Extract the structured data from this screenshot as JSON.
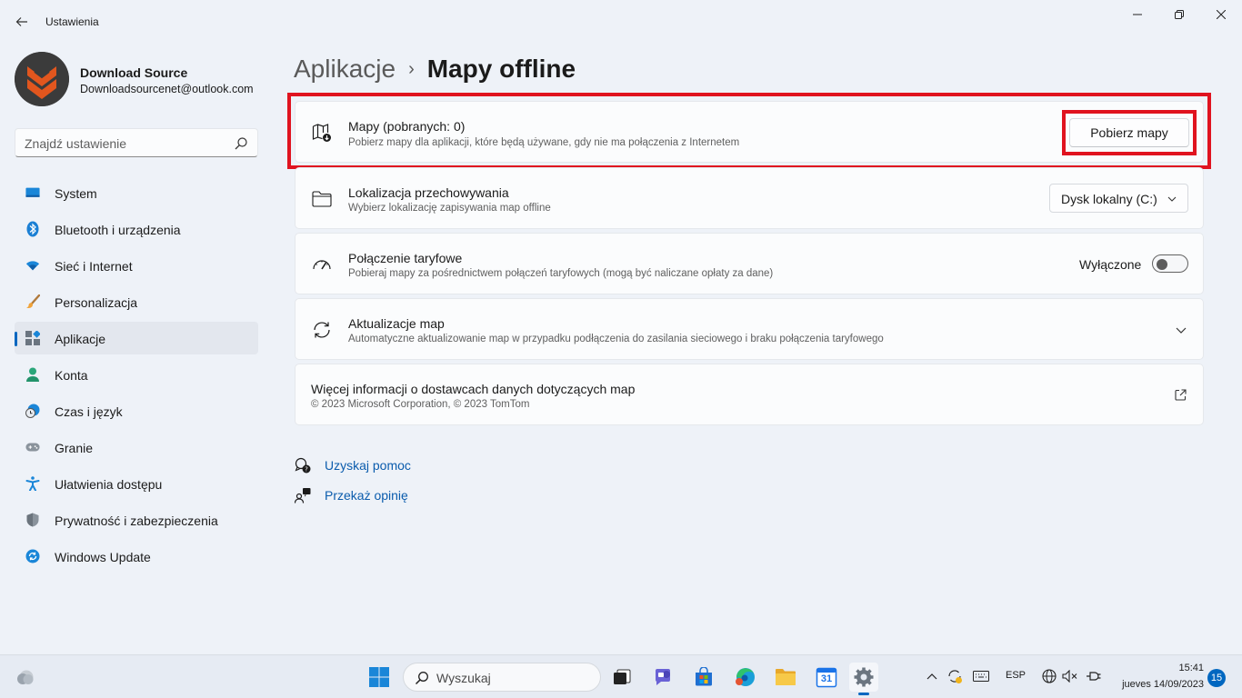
{
  "window": {
    "title": "Ustawienia"
  },
  "profile": {
    "name": "Download Source",
    "email": "Downloadsourcenet@outlook.com"
  },
  "search": {
    "placeholder": "Znajdź ustawienie"
  },
  "sidebar": {
    "items": [
      {
        "label": "System",
        "icon": "system-icon"
      },
      {
        "label": "Bluetooth i urządzenia",
        "icon": "bluetooth-icon"
      },
      {
        "label": "Sieć i Internet",
        "icon": "wifi-icon"
      },
      {
        "label": "Personalizacja",
        "icon": "brush-icon"
      },
      {
        "label": "Aplikacje",
        "icon": "apps-icon",
        "active": true
      },
      {
        "label": "Konta",
        "icon": "person-icon"
      },
      {
        "label": "Czas i język",
        "icon": "clock-globe-icon"
      },
      {
        "label": "Granie",
        "icon": "gamepad-icon"
      },
      {
        "label": "Ułatwienia dostępu",
        "icon": "accessibility-icon"
      },
      {
        "label": "Prywatność i zabezpieczenia",
        "icon": "shield-icon"
      },
      {
        "label": "Windows Update",
        "icon": "update-icon"
      }
    ]
  },
  "breadcrumb": {
    "parent": "Aplikacje",
    "separator": "›",
    "current": "Mapy offline"
  },
  "cards": {
    "maps": {
      "title": "Mapy (pobranych: 0)",
      "subtitle": "Pobierz mapy dla aplikacji, które będą używane, gdy nie ma połączenia z Internetem",
      "button": "Pobierz mapy"
    },
    "storage": {
      "title": "Lokalizacja przechowywania",
      "subtitle": "Wybierz lokalizację zapisywania map offline",
      "dropdown_value": "Dysk lokalny (C:)"
    },
    "metered": {
      "title": "Połączenie taryfowe",
      "subtitle": "Pobieraj mapy za pośrednictwem połączeń taryfowych (mogą być naliczane opłaty za dane)",
      "toggle_label": "Wyłączone",
      "toggle_on": false
    },
    "updates": {
      "title": "Aktualizacje map",
      "subtitle": "Automatyczne aktualizowanie map w przypadku podłączenia do zasilania sieciowego i braku połączenia taryfowego"
    },
    "info": {
      "title": "Więcej informacji o dostawcach danych dotyczących map",
      "subtitle": "© 2023 Microsoft Corporation, © 2023 TomTom"
    }
  },
  "links": {
    "help": "Uzyskaj pomoc",
    "feedback": "Przekaż opinię"
  },
  "taskbar": {
    "search_text": "Wyszukaj",
    "language": "ESP",
    "time": "15:41",
    "date": "jueves 14/09/2023",
    "notification_count": "15",
    "calendar_day": "31"
  },
  "colors": {
    "accent": "#0067c0",
    "highlight": "#e0131f",
    "background": "#eef2f8",
    "card": "#fbfcfd"
  }
}
